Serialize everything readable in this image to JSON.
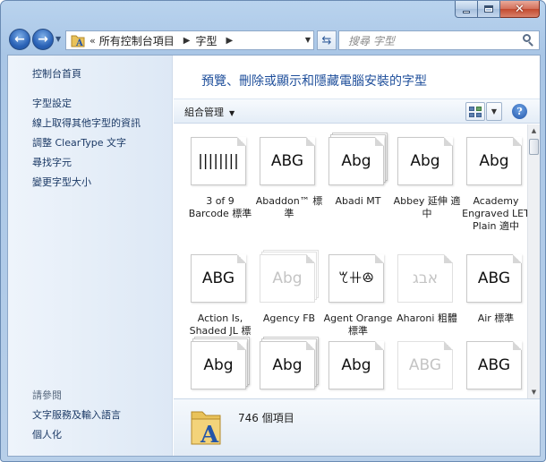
{
  "window": {
    "caption_buttons": {
      "minimize_icon": "minimize-icon",
      "maximize_icon": "maximize-icon",
      "close_icon": "close-icon"
    }
  },
  "nav": {
    "back_icon": "arrow-left-icon",
    "forward_icon": "arrow-right-icon",
    "address": {
      "overflow": "«",
      "segments": [
        "所有控制台項目",
        "字型"
      ]
    },
    "search_placeholder": "搜尋 字型"
  },
  "sidebar": {
    "items": [
      {
        "label": "控制台首頁"
      },
      {
        "label": "字型設定"
      },
      {
        "label": "線上取得其他字型的資訊"
      },
      {
        "label": "調整 ClearType 文字"
      },
      {
        "label": "尋找字元"
      },
      {
        "label": "變更字型大小"
      }
    ],
    "see_also": {
      "heading": "請參閱",
      "items": [
        {
          "label": "文字服務及輸入語言"
        },
        {
          "label": "個人化"
        }
      ]
    }
  },
  "main": {
    "title": "預覽、刪除或顯示和隱藏電腦安裝的字型",
    "toolbar": {
      "organize": "組合管理",
      "help": "?"
    }
  },
  "fonts": [
    {
      "name": "3 of 9 Barcode 標準",
      "sample": "||||||||",
      "stacked": false,
      "hidden": false
    },
    {
      "name": "Abaddon™ 標準",
      "sample": "ABG",
      "stacked": false,
      "hidden": false
    },
    {
      "name": "Abadi MT",
      "sample": "Abg",
      "stacked": true,
      "hidden": false
    },
    {
      "name": "Abbey 延伸 適中",
      "sample": "Abg",
      "stacked": false,
      "hidden": false
    },
    {
      "name": "Academy Engraved LET Plain 適中",
      "sample": "Abg",
      "stacked": false,
      "hidden": false
    },
    {
      "name": "Action Is, Shaded JL 標準",
      "sample": "ABG",
      "stacked": false,
      "hidden": false
    },
    {
      "name": "Agency FB",
      "sample": "Abg",
      "stacked": true,
      "hidden": true
    },
    {
      "name": "Agent Orange 標準",
      "sample": "ꕎꔠꔮ",
      "stacked": false,
      "hidden": false
    },
    {
      "name": "Aharoni 粗體",
      "sample": "אבג",
      "stacked": false,
      "hidden": true
    },
    {
      "name": "Air 標準",
      "sample": "ABG",
      "stacked": false,
      "hidden": false
    },
    {
      "name": "",
      "sample": "Abg",
      "stacked": true,
      "hidden": false
    },
    {
      "name": "",
      "sample": "Abg",
      "stacked": true,
      "hidden": false
    },
    {
      "name": "",
      "sample": "Abg",
      "stacked": false,
      "hidden": false
    },
    {
      "name": "",
      "sample": "ABG",
      "stacked": false,
      "hidden": true
    },
    {
      "name": "",
      "sample": "ABG",
      "stacked": false,
      "hidden": false
    }
  ],
  "details": {
    "count": "746 個項目"
  }
}
